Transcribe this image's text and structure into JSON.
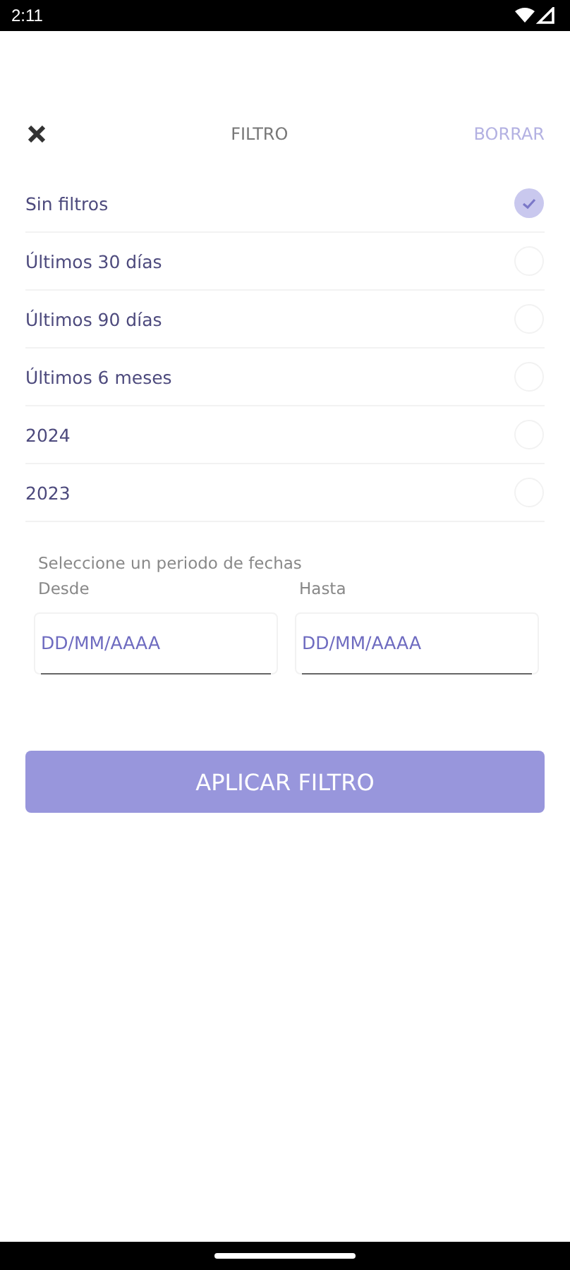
{
  "status_bar": {
    "time": "2:11"
  },
  "header": {
    "title": "FILTRO",
    "clear": "BORRAR"
  },
  "options": [
    {
      "label": "Sin filtros",
      "selected": true
    },
    {
      "label": "Últimos 30 días",
      "selected": false
    },
    {
      "label": "Últimos 90 días",
      "selected": false
    },
    {
      "label": "Últimos 6 meses",
      "selected": false
    },
    {
      "label": "2024",
      "selected": false
    },
    {
      "label": "2023",
      "selected": false
    }
  ],
  "date_range": {
    "prompt": "Seleccione un periodo de fechas",
    "fields": [
      {
        "label": "Desde",
        "placeholder": "DD/MM/AAAA"
      },
      {
        "label": "Hasta",
        "placeholder": "DD/MM/AAAA"
      }
    ]
  },
  "apply_button": "APLICAR FILTRO"
}
